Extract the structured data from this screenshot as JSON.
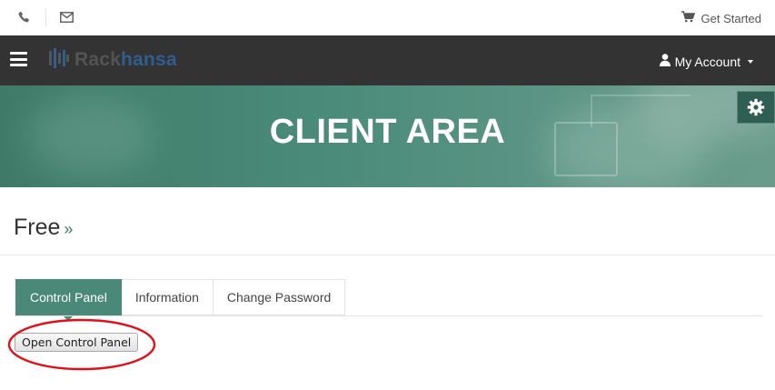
{
  "topbar": {
    "phone_icon": "phone-icon",
    "mail_icon": "envelope-icon",
    "get_started": "Get Started",
    "cart_icon": "cart-icon"
  },
  "navbar": {
    "logo_part1": "Rack",
    "logo_part2": "hansa",
    "account_label": "My Account",
    "menu_icon": "hamburger-icon",
    "user_icon": "user-icon"
  },
  "hero": {
    "title": "CLIENT AREA",
    "settings_icon": "gear-icon"
  },
  "page": {
    "title": "Free",
    "title_suffix": "»"
  },
  "tabs": [
    {
      "label": "Control Panel",
      "active": true
    },
    {
      "label": "Information",
      "active": false
    },
    {
      "label": "Change Password",
      "active": false
    }
  ],
  "actions": {
    "open_control_panel": "Open Control Panel"
  },
  "colors": {
    "navbar": "#333333",
    "accent": "#4a8878",
    "logo_dark": "#545454",
    "logo_blue": "#2f5e8f",
    "annotation": "#e0101a"
  }
}
